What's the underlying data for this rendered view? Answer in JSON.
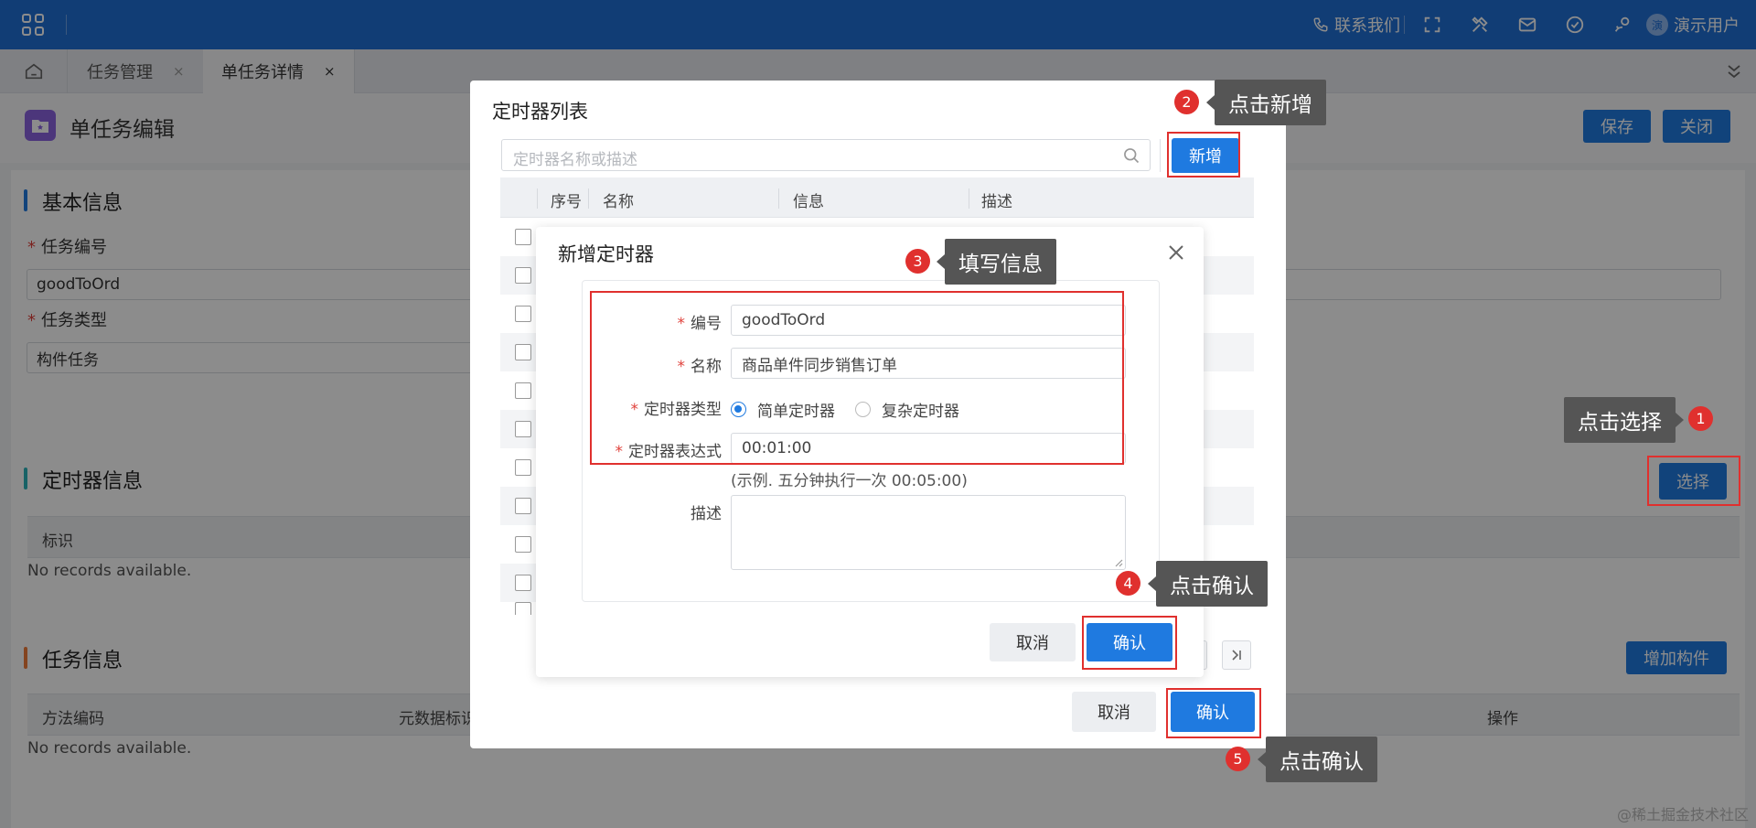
{
  "topbar": {
    "contact_label": "联系我们",
    "user_avatar_char": "演",
    "user_name": "演示用户"
  },
  "tabs": [
    {
      "label": "任务管理",
      "close": "×"
    },
    {
      "label": "单任务详情",
      "close": "×"
    }
  ],
  "page": {
    "title": "单任务编辑",
    "save_label": "保存",
    "close_label": "关闭"
  },
  "basic": {
    "title": "基本信息",
    "task_no_label": "任务编号",
    "task_no_value": "goodToOrd",
    "task_type_label": "任务类型",
    "task_type_value": "构件任务",
    "required_mark": "*"
  },
  "timer_section": {
    "title": "定时器信息",
    "select_label": "选择",
    "col_id": "标识",
    "empty": "No records available."
  },
  "task_section": {
    "title": "任务信息",
    "add_component_label": "增加构件",
    "col_method": "方法编码",
    "col_meta": "元数据标识",
    "col_ops": "操作",
    "empty": "No records available."
  },
  "timer_list_modal": {
    "title": "定时器列表",
    "search_placeholder": "定时器名称或描述",
    "add_label": "新增",
    "columns": [
      "序号",
      "名称",
      "信息",
      "描述"
    ],
    "cancel_label": "取消",
    "confirm_label": "确认"
  },
  "new_timer_modal": {
    "title": "新增定时器",
    "code_label": "编号",
    "code_value": "goodToOrd",
    "name_label": "名称",
    "name_value": "商品单件同步销售订单",
    "type_label": "定时器类型",
    "type_options": [
      "简单定时器",
      "复杂定时器"
    ],
    "type_selected": "简单定时器",
    "expr_label": "定时器表达式",
    "expr_value": "00:01:00",
    "expr_hint": "(示例. 五分钟执行一次 00:05:00)",
    "desc_label": "描述",
    "cancel_label": "取消",
    "confirm_label": "确认"
  },
  "annotations": [
    {
      "num": "1",
      "text": "点击选择"
    },
    {
      "num": "2",
      "text": "点击新增"
    },
    {
      "num": "3",
      "text": "填写信息"
    },
    {
      "num": "4",
      "text": "点击确认"
    },
    {
      "num": "5",
      "text": "点击确认"
    }
  ],
  "watermark": "@稀土掘金技术社区",
  "colors": {
    "topbar": "#1f6fd6",
    "primary_button": "#1f7ae0",
    "highlight": "#e0302e",
    "callout": "#555555"
  },
  "icons": [
    "apps-grid-icon",
    "phone-icon",
    "fullscreen-icon",
    "tools-icon",
    "mail-icon",
    "check-circle-icon",
    "user-location-icon",
    "home-icon",
    "chevron-double-down-icon",
    "page-icon",
    "search-icon",
    "close-icon",
    "last-page-icon"
  ]
}
